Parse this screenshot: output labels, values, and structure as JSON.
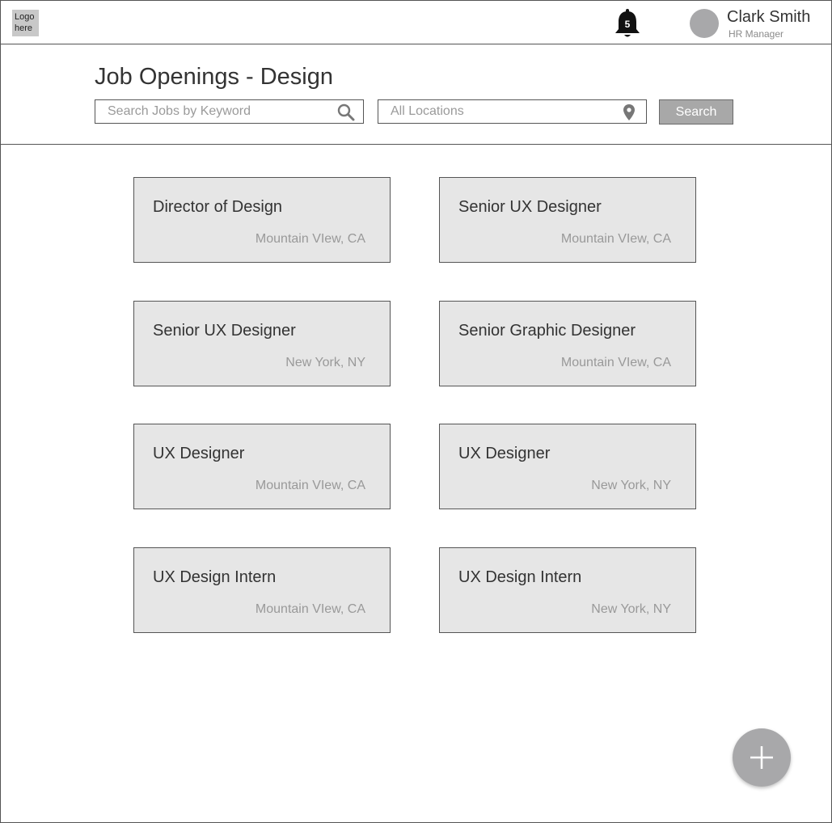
{
  "logo": {
    "text": "Logo here"
  },
  "notifications": {
    "count": "5"
  },
  "user": {
    "name": "Clark Smith",
    "role": "HR Manager"
  },
  "page": {
    "title": "Job Openings - Design"
  },
  "search": {
    "keyword_placeholder": "Search Jobs by Keyword",
    "keyword_value": "",
    "location_placeholder": "All Locations",
    "location_value": "",
    "button_label": "Search"
  },
  "jobs": [
    {
      "title": "Director of Design",
      "location": "Mountain VIew, CA"
    },
    {
      "title": "Senior UX Designer",
      "location": "Mountain VIew, CA"
    },
    {
      "title": "Senior UX Designer",
      "location": "New York, NY"
    },
    {
      "title": "Senior Graphic Designer",
      "location": "Mountain VIew, CA"
    },
    {
      "title": "UX Designer",
      "location": "Mountain VIew, CA"
    },
    {
      "title": "UX Designer",
      "location": "New York, NY"
    },
    {
      "title": "UX Design Intern",
      "location": "Mountain VIew, CA"
    },
    {
      "title": "UX Design Intern",
      "location": "New York, NY"
    }
  ],
  "icons": {
    "notifications": "bell-icon",
    "keyword_search": "magnifier-icon",
    "location": "map-pin-icon",
    "add": "plus-icon"
  },
  "colors": {
    "card_background": "#e6e6e6",
    "button_background": "#a8a8a8",
    "avatar": "#a8a8aa",
    "bell": "#111111"
  }
}
